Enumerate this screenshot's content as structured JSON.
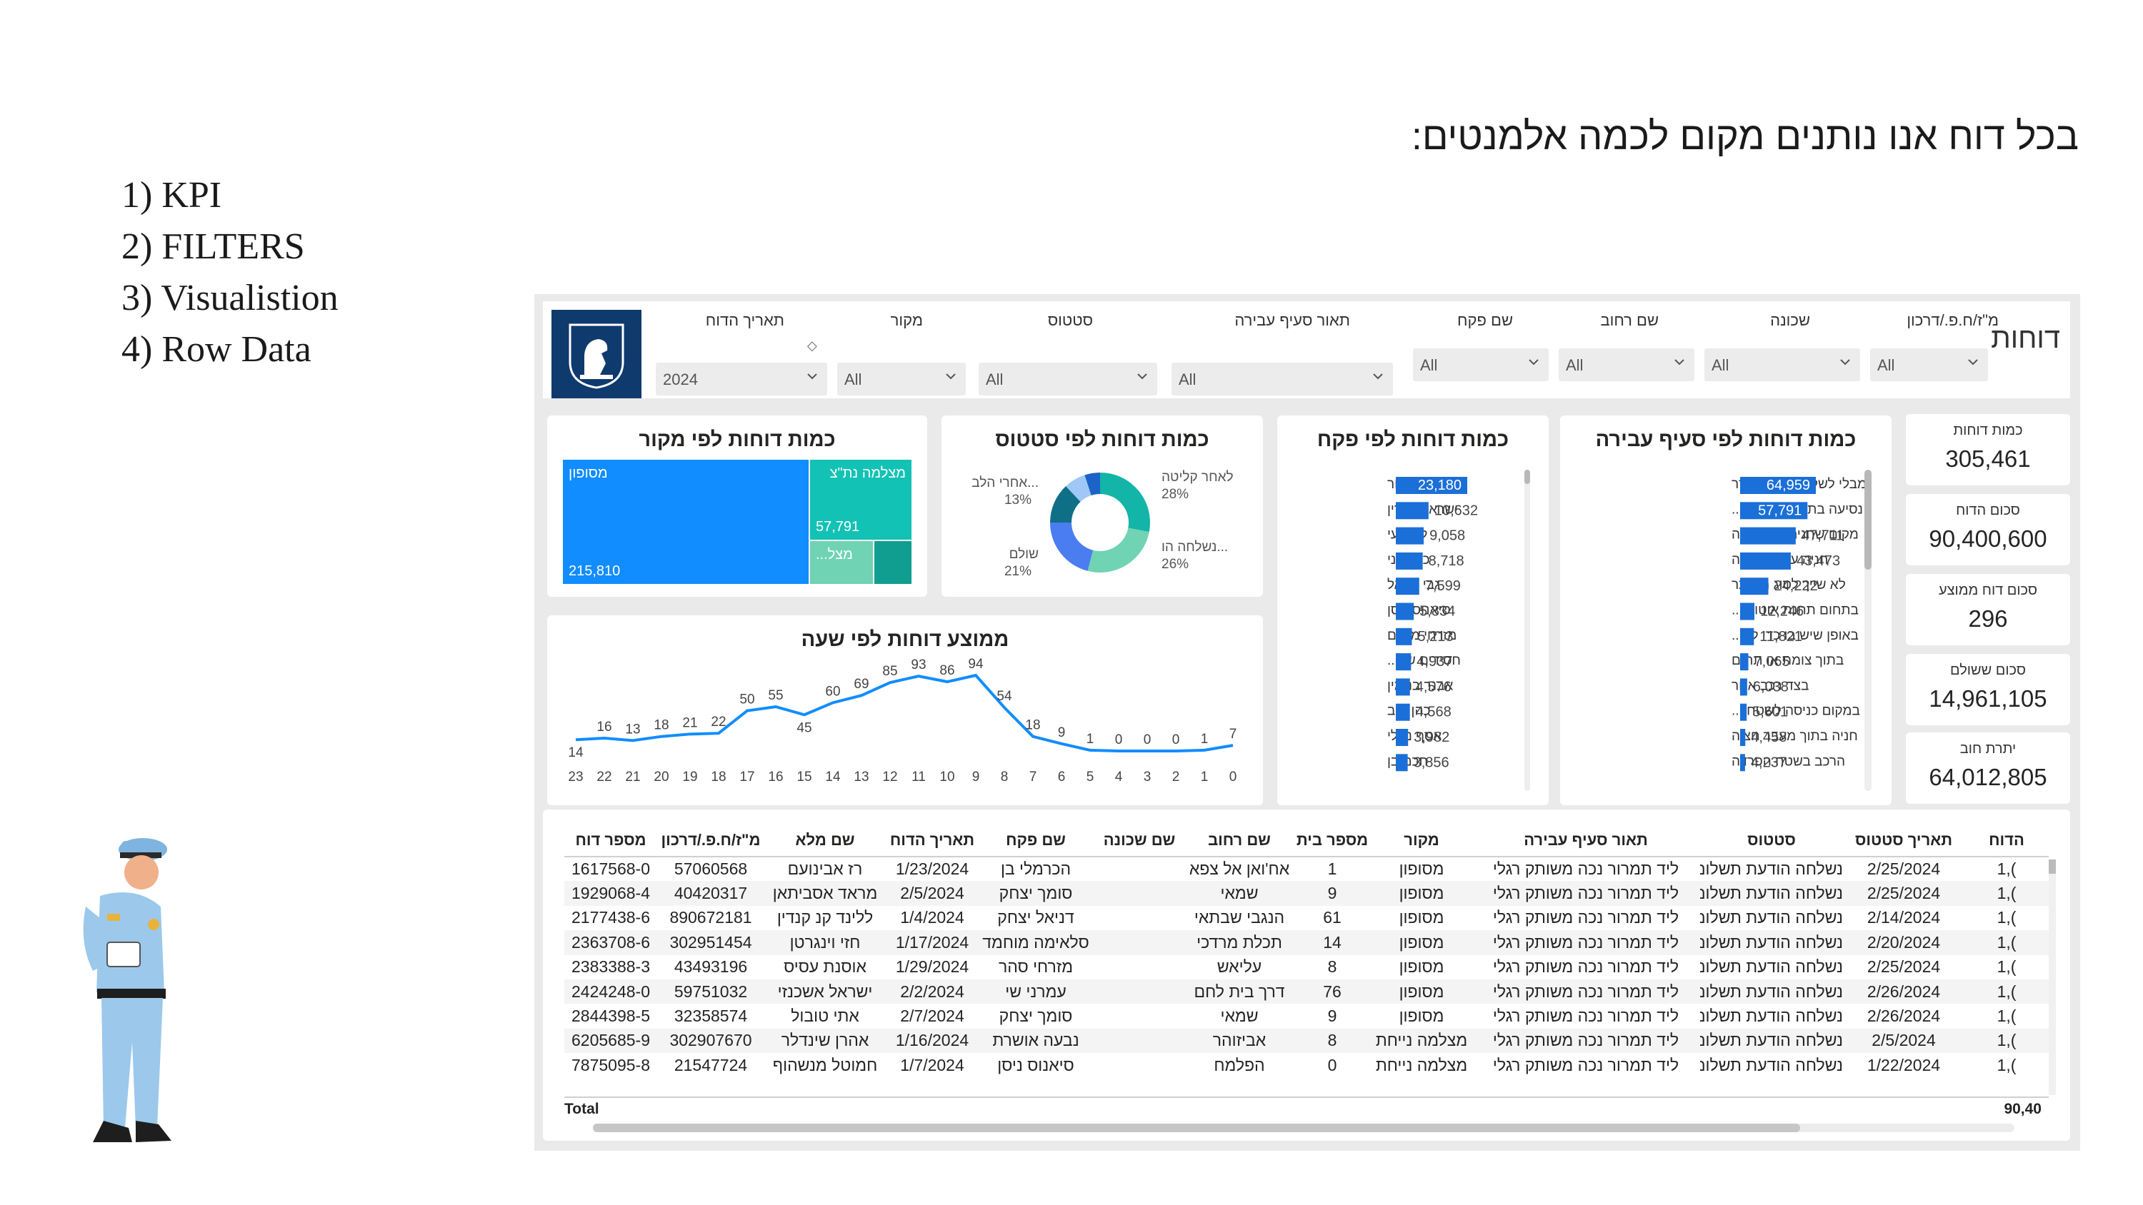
{
  "slide": {
    "title": "בכל דוח אנו נותנים מקום לכמה אלמנטים:",
    "list": [
      "1)  KPI",
      "2) FILTERS",
      "3) Visualistion",
      "4) Row Data"
    ]
  },
  "dashboard": {
    "page_name": "דוחות",
    "logo_text": "ירושלים",
    "filters": [
      {
        "label": "תאריך הדוח",
        "value": "2024"
      },
      {
        "label": "מקור",
        "value": "All"
      },
      {
        "label": "סטטוס",
        "value": "All"
      },
      {
        "label": "תאור סעיף עבירה",
        "value": "All"
      },
      {
        "label": "שם פקח",
        "value": "All"
      },
      {
        "label": "שם רחוב",
        "value": "All"
      },
      {
        "label": "שכונה",
        "value": "All"
      },
      {
        "label": "מ\"ז/ח.פ./דרכון",
        "value": "All"
      }
    ],
    "kpis": [
      {
        "label": "כמות דוחות",
        "value": "305,461"
      },
      {
        "label": "סכום הדוח",
        "value": "90,400,600"
      },
      {
        "label": "סכום דוח ממוצע",
        "value": "296"
      },
      {
        "label": "סכום ששולם",
        "value": "14,961,105"
      },
      {
        "label": "יתרת חוב",
        "value": "64,012,805"
      }
    ],
    "treemap": {
      "title": "כמות דוחות לפי מקור",
      "tiles": [
        {
          "label": "מסופון",
          "value": "215,810",
          "color": "#118dff"
        },
        {
          "label": "מצלמה נת\"צ",
          "value": "57,791",
          "color": "#12c2b5"
        },
        {
          "label": "מצל...",
          "value": "",
          "color": "#6fd3b4"
        },
        {
          "label": "",
          "value": "",
          "color": "#0f9e8f"
        }
      ]
    },
    "donut": {
      "title": "כמות דוחות לפי סטטוס",
      "slices": [
        {
          "label": "לאחר קליטה",
          "pct": "28%",
          "value": 28,
          "color": "#12b5a8"
        },
        {
          "label": "נשלחה הו...",
          "pct": "26%",
          "value": 26,
          "color": "#6fd3b4"
        },
        {
          "label": "שולם",
          "pct": "21%",
          "value": 21,
          "color": "#4a7df0"
        },
        {
          "label": "אחרי הלב...",
          "pct": "13%",
          "value": 13,
          "color": "#0f6f86"
        },
        {
          "label": "",
          "pct": "",
          "value": 7,
          "color": "#9fc8f7"
        },
        {
          "label": "",
          "pct": "",
          "value": 5,
          "color": "#1d63c7"
        }
      ]
    },
    "inspector_chart": {
      "title": "כמות דוחות לפי פקח",
      "labels": [
        "ציוני לימור",
        "ישראל קארין",
        "לוי רועי",
        "כהן ליני",
        "גבי דניאל",
        "סיאנוס ניסן",
        "מזרחי מנחם",
        "חסידים של...",
        "אבנר בנימין",
        "כהן יניב",
        "אסף נטלי",
        "חכם בן"
      ],
      "values": [
        23180,
        10632,
        9058,
        8718,
        7599,
        5834,
        5213,
        4937,
        4576,
        4568,
        3982,
        3856
      ],
      "value_labels": [
        "23,180",
        "10,632",
        "9,058",
        "8,718",
        "7,599",
        "5,834",
        "5,213",
        "4,937",
        "4,576",
        "4,568",
        "3,982",
        "3,856"
      ]
    },
    "offense_chart": {
      "title": "כמות דוחות לפי סעיף עבירה",
      "labels": [
        "מבלי לשלם אגרת הסדר",
        "נסיעה בתחום נתיב ת...",
        "מקום שחניה בו נאסרה",
        "חניה על המדרכה",
        "לא שייך לסוג המותר",
        "בתחום תחנת אוטובו...",
        "באופן שיש בו כדי לה...",
        "בתוך צומת או תחום",
        "בצד רכב אחר",
        "במקום כניסה לשטח ...",
        "חניה בתוך מעבר חציה",
        "הרכב בשטח הפרדה"
      ],
      "values": [
        64959,
        57791,
        47711,
        43473,
        24222,
        12246,
        11821,
        7065,
        6038,
        5601,
        4458,
        4237
      ],
      "value_labels": [
        "64,959",
        "57,791",
        "47,711",
        "43,473",
        "24,222",
        "12,246",
        "11,821",
        "7,065",
        "6,038",
        "5,601",
        "4,458",
        "4,237"
      ]
    },
    "hourly_chart": {
      "title": "ממוצע דוחות לפי שעה",
      "x_labels": [
        "23",
        "22",
        "21",
        "20",
        "19",
        "18",
        "17",
        "16",
        "15",
        "14",
        "13",
        "12",
        "11",
        "10",
        "9",
        "8",
        "7",
        "6",
        "5",
        "4",
        "3",
        "2",
        "1",
        "0"
      ],
      "values": [
        14,
        16,
        13,
        18,
        21,
        22,
        50,
        55,
        45,
        60,
        69,
        85,
        93,
        86,
        94,
        54,
        18,
        9,
        1,
        0,
        0,
        0,
        1,
        7
      ],
      "color": "#118dff"
    },
    "table": {
      "headers": [
        "מספר דוח",
        "מ\"ז/ח.פ./דרכון",
        "שם מלא",
        "תאריך הדוח",
        "שם פקח",
        "שם שכונה",
        "שם רחוב",
        "מספר בית",
        "מקור",
        "תאור סעיף עבירה",
        "סטטוס",
        "תאריך סטטוס",
        "הדוח"
      ],
      "rows": [
        [
          "1617568-0",
          "57060568",
          "רז אבינועם",
          "1/23/2024",
          "הכרמלי בן",
          "",
          "אח'ואן אל צפא",
          "1",
          "מסופון",
          "ליד תמרור נכה משותק רגלי",
          "נשלחה הודעת תשלום",
          "2/25/2024",
          "1,("
        ],
        [
          "1929068-4",
          "40420317",
          "מראד אסביתאן",
          "2/5/2024",
          "סומך יצחק",
          "",
          "שמאי",
          "9",
          "מסופון",
          "ליד תמרור נכה משותק רגלי",
          "נשלחה הודעת תשלום",
          "2/25/2024",
          "1,("
        ],
        [
          "2177438-6",
          "890672181",
          "ללינד קנ קנדין",
          "1/4/2024",
          "דניאל יצחק",
          "",
          "הנגבי שבתאי",
          "61",
          "מסופון",
          "ליד תמרור נכה משותק רגלי",
          "נשלחה הודעת תשלום",
          "2/14/2024",
          "1,("
        ],
        [
          "2363708-6",
          "302951454",
          "חזי וינגרטן",
          "1/17/2024",
          "סלאימה מוחמד",
          "",
          "תכלת מרדכי",
          "14",
          "מסופון",
          "ליד תמרור נכה משותק רגלי",
          "נשלחה הודעת תשלום",
          "2/20/2024",
          "1,("
        ],
        [
          "2383388-3",
          "43493196",
          "אוסנת עסיס",
          "1/29/2024",
          "מזרחי סהר",
          "",
          "עליאש",
          "8",
          "מסופון",
          "ליד תמרור נכה משותק רגלי",
          "נשלחה הודעת תשלום",
          "2/25/2024",
          "1,("
        ],
        [
          "2424248-0",
          "59751032",
          "ישראל אשכנזי",
          "2/2/2024",
          "עמרני שי",
          "",
          "דרך בית לחם",
          "76",
          "מסופון",
          "ליד תמרור נכה משותק רגלי",
          "נשלחה הודעת תשלום",
          "2/26/2024",
          "1,("
        ],
        [
          "2844398-5",
          "32358574",
          "אתי טובול",
          "2/7/2024",
          "סומך יצחק",
          "",
          "שמאי",
          "9",
          "מסופון",
          "ליד תמרור נכה משותק רגלי",
          "נשלחה הודעת תשלום",
          "2/26/2024",
          "1,("
        ],
        [
          "6205685-9",
          "302907670",
          "אהרן שינדלר",
          "1/16/2024",
          "נבעה אושרת",
          "",
          "אביזוהר",
          "8",
          "מצלמה נייחת",
          "ליד תמרור נכה משותק רגלי",
          "נשלחה הודעת תשלום",
          "2/5/2024",
          "1,("
        ],
        [
          "7875095-8",
          "21547724",
          "חמוטל מנשהוף",
          "1/7/2024",
          "סיאנוס ניסן",
          "",
          "הפלמח",
          "0",
          "מצלמה נייחת",
          "ליד תמרור נכה משותק רגלי",
          "נשלחה הודעת תשלום",
          "1/22/2024",
          "1,("
        ]
      ],
      "total_label": "Total",
      "total_value": "90,40"
    }
  }
}
